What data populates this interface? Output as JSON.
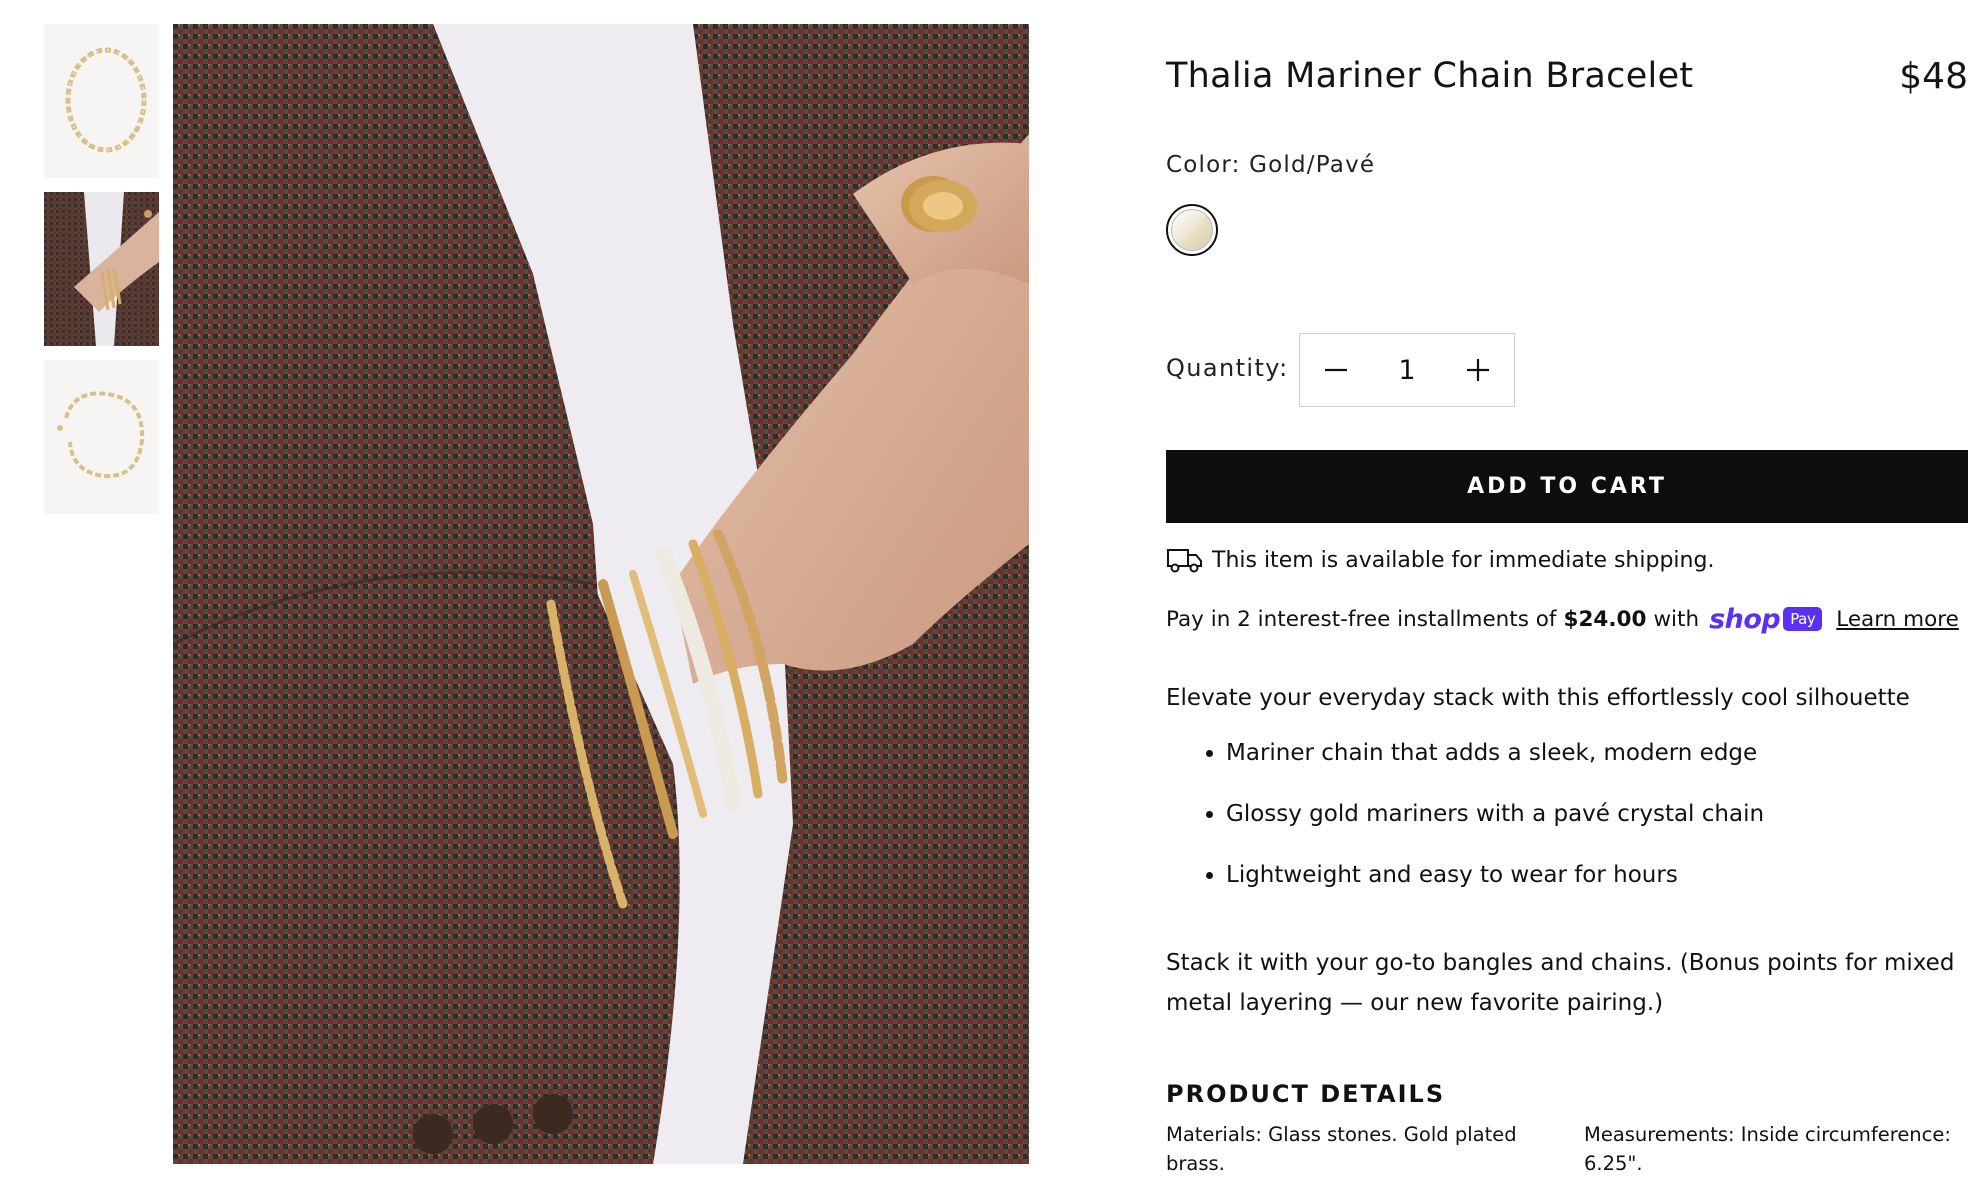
{
  "product": {
    "title": "Thalia Mariner Chain Bracelet",
    "price": "$48",
    "color_label": "Color: Gold/Pavé",
    "swatch_name": "Gold/Pavé",
    "quantity_label": "Quantity:",
    "quantity_value": "1",
    "add_to_cart_label": "ADD TO CART",
    "shipping_text": "This item is available for immediate shipping.",
    "installments": {
      "prefix": "Pay in 2 interest-free installments of",
      "amount": "$24.00",
      "suffix": "with",
      "shop_logo": "shop",
      "pay_badge": "Pay",
      "learn_more": "Learn more"
    },
    "description_intro": "Elevate your everyday stack with this effortlessly cool silhouette",
    "bullets": [
      "Mariner chain that adds a sleek, modern edge",
      "Glossy gold mariners with a pavé crystal chain",
      "Lightweight and easy to wear for hours"
    ],
    "stack_text": "Stack it with your go-to bangles and chains. (Bonus points for mixed metal layering — our new favorite pairing.)",
    "details_heading": "PRODUCT DETAILS",
    "materials": "Materials: Glass stones. Gold plated brass.",
    "measurements": "Measurements: Inside circumference: 6.25\"."
  },
  "gallery": {
    "thumbnails": [
      "bracelet-flat",
      "bracelet-on-wrist",
      "bracelet-open"
    ],
    "selected_index": 1
  },
  "colors": {
    "button_bg": "#0d0d0d",
    "shop_pay": "#5a31f4",
    "text": "#111111"
  },
  "icons": {
    "minus": "minus-icon",
    "plus": "plus-icon",
    "truck": "truck-icon"
  }
}
